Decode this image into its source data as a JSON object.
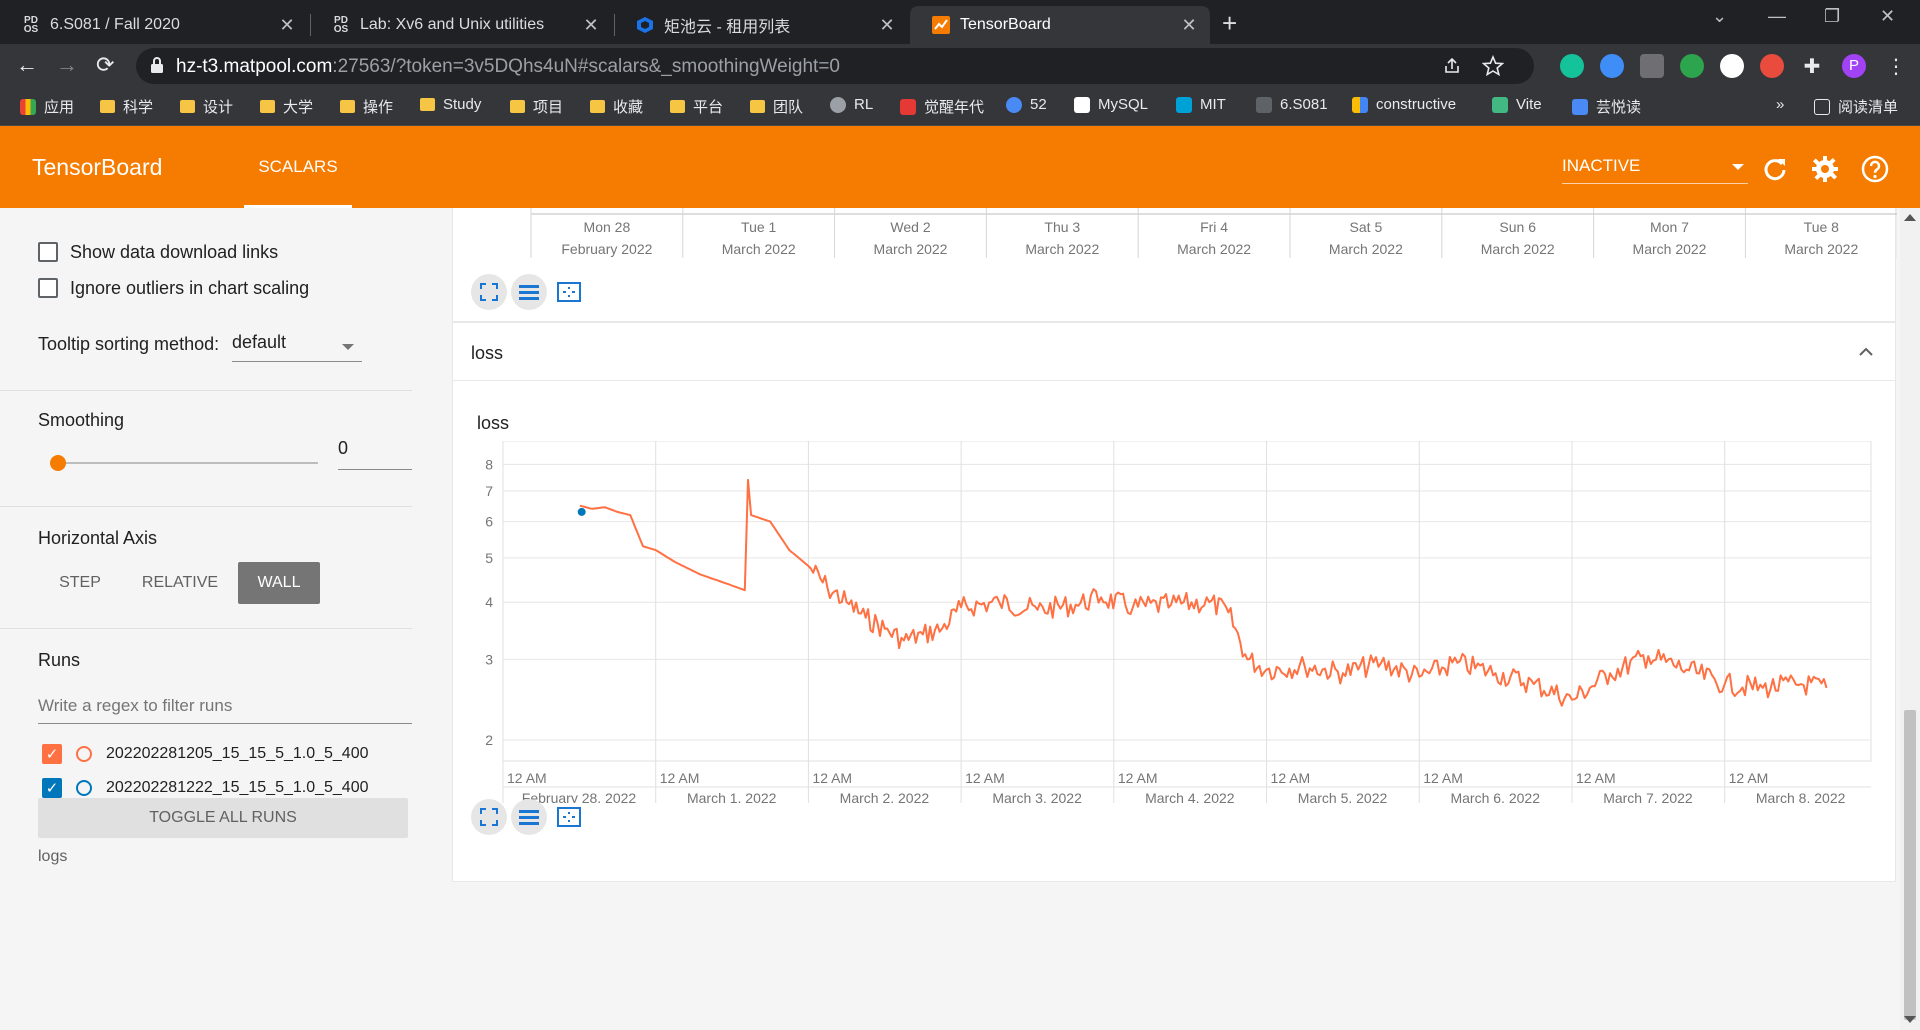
{
  "browser": {
    "tabs": [
      {
        "favicon": "PD OS",
        "title": "6.S081 / Fall 2020"
      },
      {
        "favicon": "PD OS",
        "title": "Lab: Xv6 and Unix utilities"
      },
      {
        "favicon": "matpool-icon",
        "title": "矩池云 - 租用列表"
      },
      {
        "favicon": "tensorboard-icon",
        "title": "TensorBoard"
      }
    ],
    "url_host": "hz-t3.matpool.com",
    "url_rest": ":27563/?token=3v5DQhs4uN#scalars&_smoothingWeight=0",
    "bookmarks": [
      {
        "label": "应用",
        "kind": "apps"
      },
      {
        "label": "科学",
        "kind": "folder"
      },
      {
        "label": "设计",
        "kind": "folder"
      },
      {
        "label": "大学",
        "kind": "folder"
      },
      {
        "label": "操作",
        "kind": "folder"
      },
      {
        "label": "Study",
        "kind": "folder"
      },
      {
        "label": "项目",
        "kind": "folder"
      },
      {
        "label": "收藏",
        "kind": "folder"
      },
      {
        "label": "平台",
        "kind": "folder"
      },
      {
        "label": "团队",
        "kind": "folder"
      },
      {
        "label": "RL",
        "kind": "site"
      },
      {
        "label": "觉醒年代",
        "kind": "site"
      },
      {
        "label": "52",
        "kind": "site"
      },
      {
        "label": "MySQL",
        "kind": "site"
      },
      {
        "label": "MIT",
        "kind": "site"
      },
      {
        "label": "6.S081",
        "kind": "site"
      },
      {
        "label": "constructive",
        "kind": "site"
      },
      {
        "label": "Vite",
        "kind": "site"
      },
      {
        "label": "芸悦读",
        "kind": "site"
      }
    ],
    "bookmarks_more": "»",
    "reading_list": "阅读清单"
  },
  "tb": {
    "brand": "TensorBoard",
    "tab_scalars": "SCALARS",
    "plugin_select": "INACTIVE",
    "accent": "#f57c00"
  },
  "sidebar": {
    "show_download": "Show data download links",
    "ignore_outliers": "Ignore outliers in chart scaling",
    "tooltip_label": "Tooltip sorting method:",
    "tooltip_value": "default",
    "smoothing_label": "Smoothing",
    "smoothing_value": "0",
    "haxis_label": "Horizontal Axis",
    "haxis_options": [
      "STEP",
      "RELATIVE",
      "WALL"
    ],
    "haxis_selected": "WALL",
    "runs_label": "Runs",
    "runs_filter_placeholder": "Write a regex to filter runs",
    "runs": [
      {
        "name": "202202281205_15_15_5_1.0_5_400",
        "color": "#ff7043",
        "checked": true
      },
      {
        "name": "202202281222_15_15_5_1.0_5_400",
        "color": "#0077bb",
        "checked": true
      }
    ],
    "toggle_all": "TOGGLE ALL RUNS",
    "logdir": "logs"
  },
  "top_chart_axis": {
    "days": [
      "Mon 28",
      "Tue 1",
      "Wed 2",
      "Thu 3",
      "Fri 4",
      "Sat 5",
      "Sun 6",
      "Mon 7",
      "Tue 8"
    ],
    "months": [
      "February 2022",
      "March 2022",
      "March 2022",
      "March 2022",
      "March 2022",
      "March 2022",
      "March 2022",
      "March 2022",
      "March 2022"
    ]
  },
  "loss_card": {
    "header": "loss",
    "chart_title": "loss"
  },
  "chart_data": {
    "type": "line",
    "title": "loss",
    "xlabel": "",
    "ylabel": "",
    "yscale": "log",
    "ylim": [
      1.8,
      9
    ],
    "yticks": [
      "2",
      "3",
      "4",
      "5",
      "6",
      "7",
      "8"
    ],
    "ytick_values": [
      2,
      3,
      4,
      5,
      6,
      7,
      8
    ],
    "x_tick_hour": "12 AM",
    "x_tick_dates": [
      "February 28, 2022",
      "March 1, 2022",
      "March 2, 2022",
      "March 3, 2022",
      "March 4, 2022",
      "March 5, 2022",
      "March 6, 2022",
      "March 7, 2022",
      "March 8, 2022"
    ],
    "xlim": [
      "2022-02-28T00:00",
      "2022-03-08T23:00"
    ],
    "grid": true,
    "series": [
      {
        "color": "#ff7043",
        "points": [
          [
            "2022-02-28T12:05",
            6.5
          ],
          [
            "2022-02-28T14:00",
            6.4
          ],
          [
            "2022-02-28T16:00",
            6.45
          ],
          [
            "2022-02-28T18:00",
            6.3
          ],
          [
            "2022-02-28T20:00",
            6.2
          ],
          [
            "2022-02-28T22:00",
            5.3
          ],
          [
            "2022-03-01T00:00",
            5.2
          ],
          [
            "2022-03-01T03:00",
            4.9
          ],
          [
            "2022-03-01T07:00",
            4.6
          ],
          [
            "2022-03-01T11:00",
            4.4
          ],
          [
            "2022-03-01T14:00",
            4.25
          ],
          [
            "2022-03-01T14:30",
            7.4
          ],
          [
            "2022-03-01T15:00",
            6.2
          ],
          [
            "2022-03-01T18:00",
            6.0
          ],
          [
            "2022-03-01T21:00",
            5.2
          ],
          [
            "2022-03-02T00:00",
            4.8
          ],
          [
            "2022-03-02T03:00",
            4.3
          ],
          [
            "2022-03-02T06:00",
            4.0
          ],
          [
            "2022-03-02T09:00",
            3.7
          ],
          [
            "2022-03-02T12:00",
            3.5
          ],
          [
            "2022-03-02T15:00",
            3.3
          ],
          [
            "2022-03-02T18:00",
            3.4
          ],
          [
            "2022-03-02T21:00",
            3.5
          ],
          [
            "2022-03-03T00:00",
            3.9
          ],
          [
            "2022-03-03T06:00",
            4.0
          ],
          [
            "2022-03-03T12:00",
            3.85
          ],
          [
            "2022-03-03T18:00",
            3.95
          ],
          [
            "2022-03-03T22:00",
            4.1
          ],
          [
            "2022-03-04T03:00",
            3.9
          ],
          [
            "2022-03-04T09:00",
            3.95
          ],
          [
            "2022-03-04T15:00",
            4.0
          ],
          [
            "2022-03-04T18:00",
            3.8
          ],
          [
            "2022-03-04T21:00",
            3.0
          ],
          [
            "2022-03-05T00:00",
            2.85
          ],
          [
            "2022-03-05T06:00",
            2.9
          ],
          [
            "2022-03-05T12:00",
            2.8
          ],
          [
            "2022-03-05T18:00",
            2.95
          ],
          [
            "2022-03-06T00:00",
            2.75
          ],
          [
            "2022-03-06T06:00",
            2.95
          ],
          [
            "2022-03-06T12:00",
            2.8
          ],
          [
            "2022-03-06T18:00",
            2.65
          ],
          [
            "2022-03-07T00:00",
            2.45
          ],
          [
            "2022-03-07T06:00",
            2.8
          ],
          [
            "2022-03-07T12:00",
            3.05
          ],
          [
            "2022-03-07T18:00",
            2.85
          ],
          [
            "2022-03-08T00:00",
            2.65
          ],
          [
            "2022-03-08T06:00",
            2.6
          ],
          [
            "2022-03-08T12:00",
            2.65
          ],
          [
            "2022-03-08T16:00",
            2.6
          ]
        ]
      },
      {
        "color": "#0077bb",
        "points": [
          [
            "2022-02-28T12:22",
            6.3
          ]
        ]
      }
    ]
  }
}
